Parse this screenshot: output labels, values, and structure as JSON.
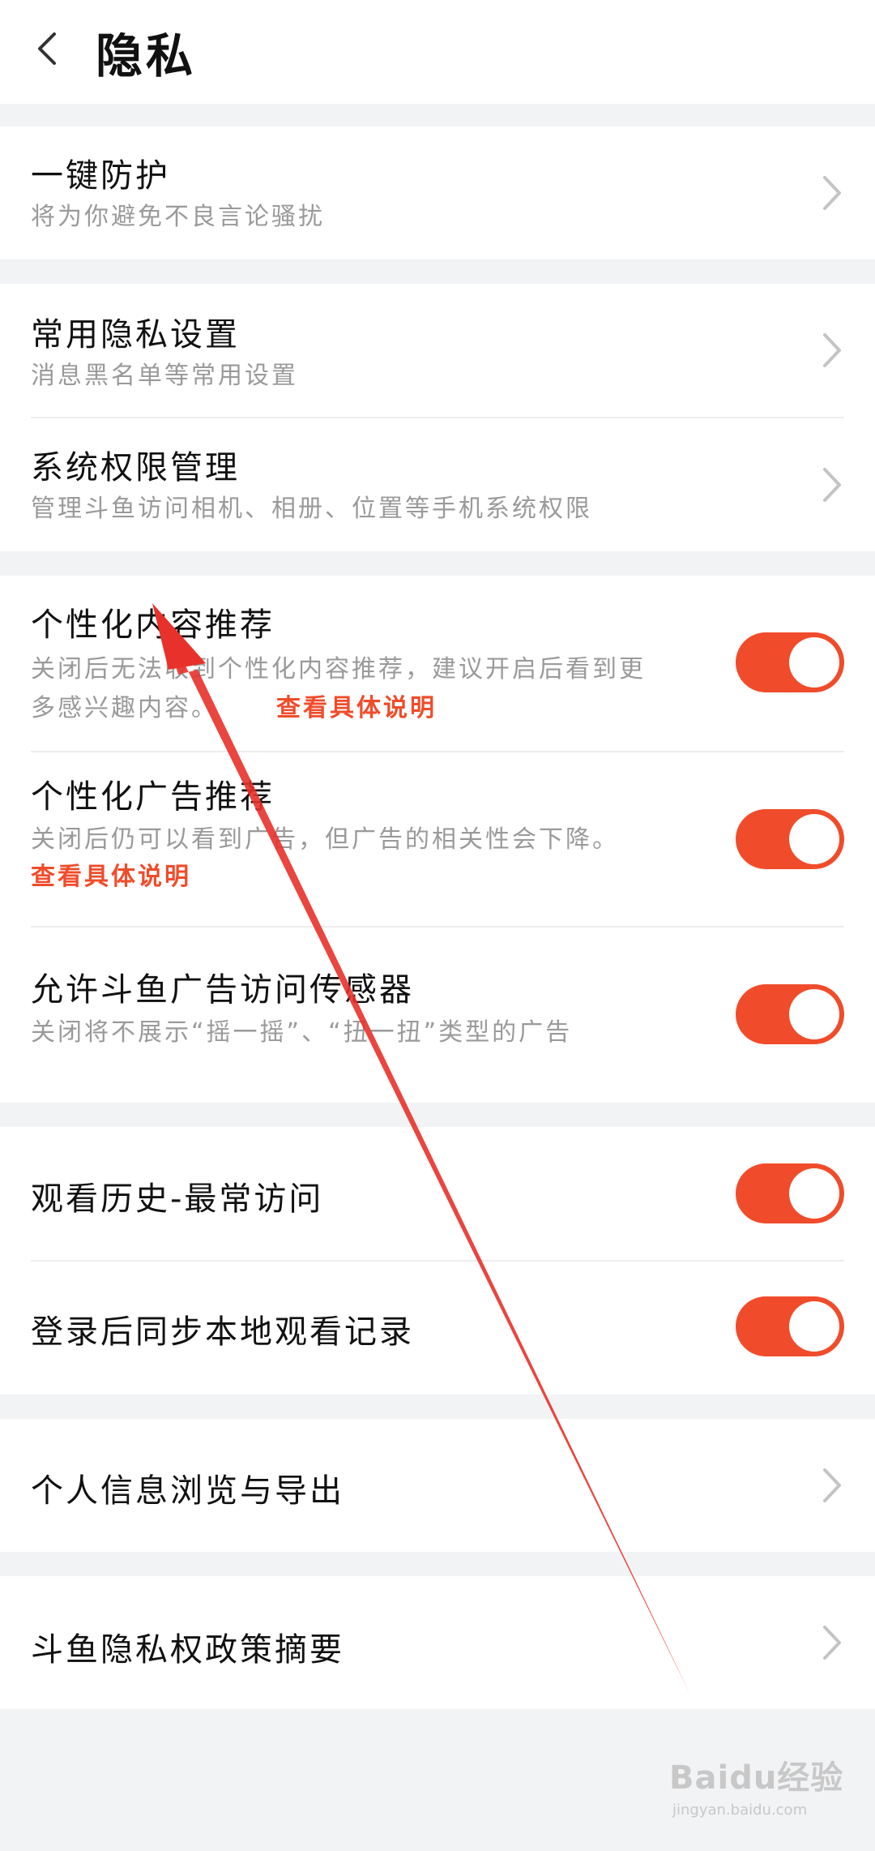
{
  "header": {
    "title": "隐私"
  },
  "groups": {
    "protect": {
      "title": "一键防护",
      "subtitle": "将为你避免不良言论骚扰"
    },
    "common": {
      "title": "常用隐私设置",
      "subtitle": "消息黑名单等常用设置"
    },
    "system": {
      "title": "系统权限管理",
      "subtitle": "管理斗鱼访问相机、相册、位置等手机系统权限"
    },
    "personalized_content": {
      "title": "个性化内容推荐",
      "subtitle_line1": "关闭后无法收到个性化内容推荐，建议开启后看到更",
      "subtitle_line2": "多感兴趣内容。",
      "link": "查看具体说明",
      "enabled": true
    },
    "personalized_ads": {
      "title": "个性化广告推荐",
      "subtitle": "关闭后仍可以看到广告，但广告的相关性会下降。",
      "link": "查看具体说明",
      "enabled": true
    },
    "sensor": {
      "title": "允许斗鱼广告访问传感器",
      "subtitle": "关闭将不展示“摇一摇”、“扭一扭”类型的广告",
      "enabled": true
    },
    "history": {
      "title": "观看历史-最常访问",
      "enabled": true
    },
    "sync": {
      "title": "登录后同步本地观看记录",
      "enabled": true
    },
    "export": {
      "title": "个人信息浏览与导出"
    },
    "policy": {
      "title": "斗鱼隐私权政策摘要"
    }
  },
  "watermark": {
    "brand": "Baidu经验",
    "url": "jingyan.baidu.com"
  },
  "colors": {
    "accent": "#f04c2b",
    "background": "#f2f3f5",
    "subtitle": "#9a9a9a"
  },
  "icons": {
    "back": "chevron-left-icon",
    "row_arrow": "chevron-right-icon"
  }
}
